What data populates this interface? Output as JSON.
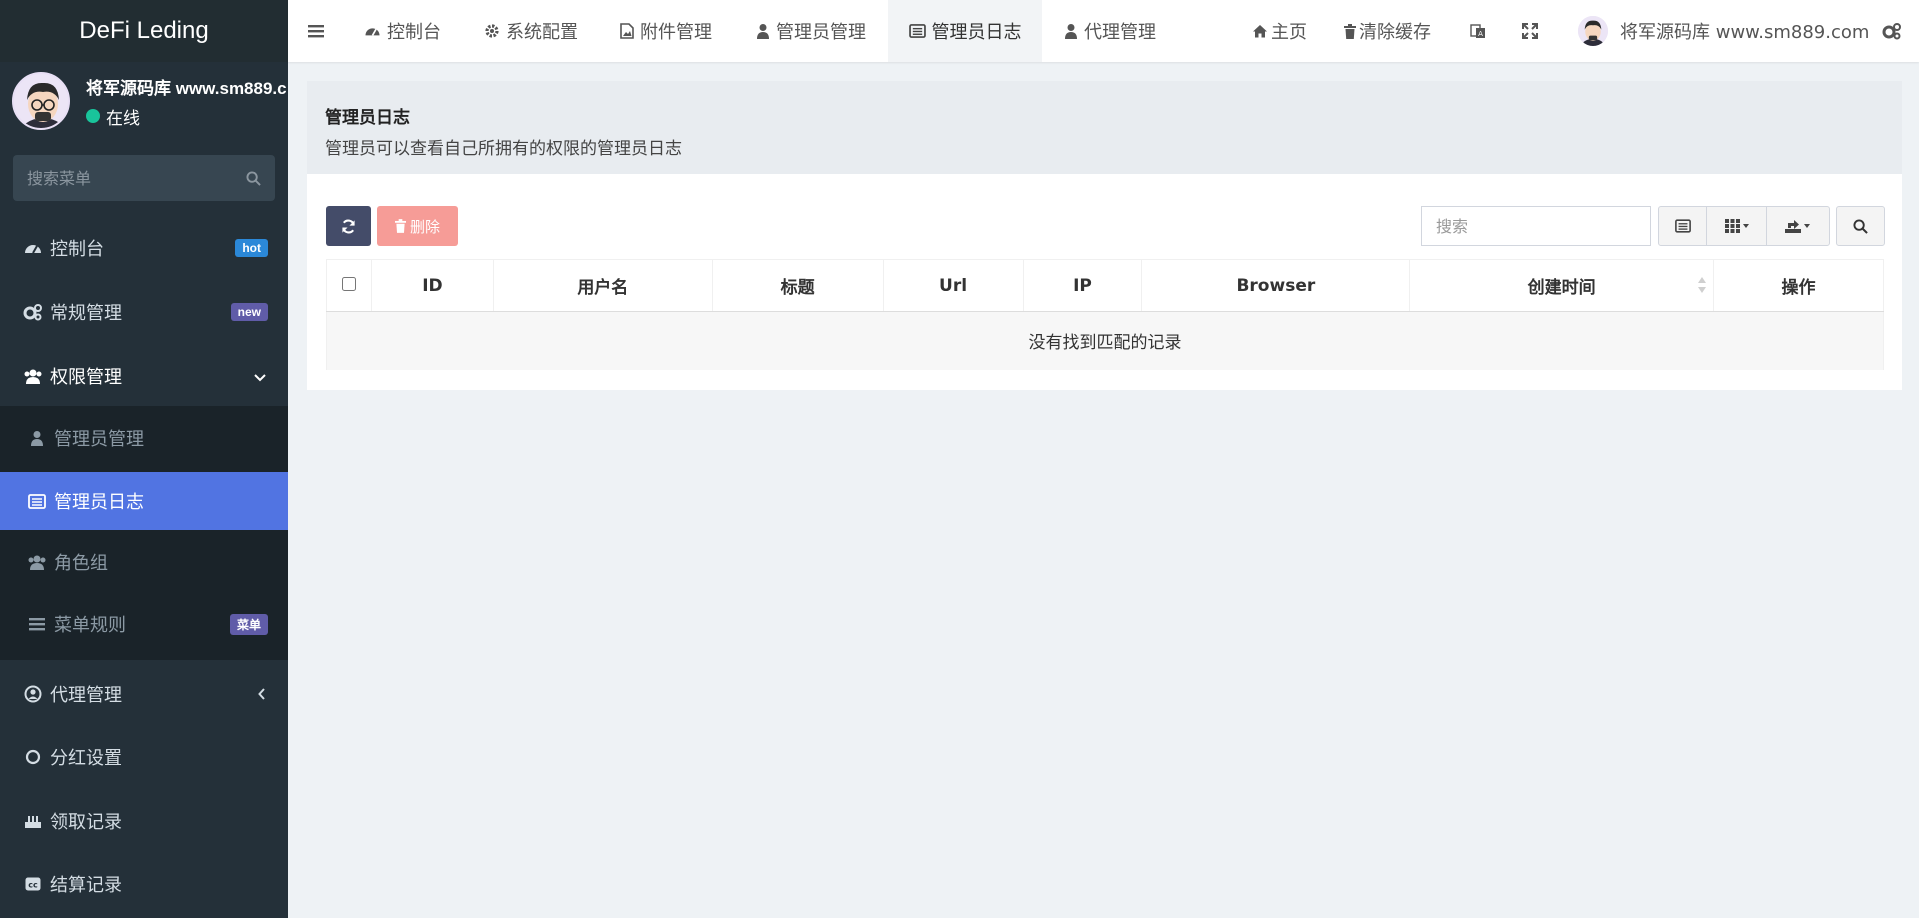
{
  "app": {
    "title": "DeFi Leding"
  },
  "user": {
    "name": "将军源码库 www.sm889.com",
    "name_truncated": "将军源码库 www.sm889.c",
    "status": "在线"
  },
  "sidebar": {
    "search_placeholder": "搜索菜单",
    "items": [
      {
        "label": "控制台",
        "icon": "dashboard-icon",
        "badge": "hot"
      },
      {
        "label": "常规管理",
        "icon": "cogs-icon",
        "badge": "new"
      },
      {
        "label": "权限管理",
        "icon": "group-icon",
        "expanded": true
      },
      {
        "label": "代理管理",
        "icon": "user-circle-icon",
        "collapsed": true
      },
      {
        "label": "分红设置",
        "icon": "circle-o-icon"
      },
      {
        "label": "领取记录",
        "icon": "birthday-cake-icon"
      },
      {
        "label": "结算记录",
        "icon": "creative-commons-icon"
      }
    ],
    "subitems": [
      {
        "label": "管理员管理",
        "icon": "user-icon"
      },
      {
        "label": "管理员日志",
        "icon": "list-alt-icon",
        "active": true
      },
      {
        "label": "角色组",
        "icon": "group-icon"
      },
      {
        "label": "菜单规则",
        "icon": "bars-icon",
        "badge": "菜单"
      }
    ]
  },
  "navbar": {
    "tabs": [
      {
        "label": "控制台",
        "icon": "dashboard-icon"
      },
      {
        "label": "系统配置",
        "icon": "cog-icon"
      },
      {
        "label": "附件管理",
        "icon": "file-image-icon"
      },
      {
        "label": "管理员管理",
        "icon": "user-icon"
      },
      {
        "label": "管理员日志",
        "icon": "list-alt-icon",
        "active": true
      },
      {
        "label": "代理管理",
        "icon": "user-icon"
      }
    ],
    "home": "主页",
    "clear_cache": "清除缓存",
    "user_name": "将军源码库 www.sm889.com"
  },
  "page": {
    "title": "管理员日志",
    "description": "管理员可以查看自己所拥有的权限的管理员日志"
  },
  "toolbar": {
    "delete_label": "删除",
    "search_placeholder": "搜索"
  },
  "table": {
    "columns": [
      "ID",
      "用户名",
      "标题",
      "Url",
      "IP",
      "Browser",
      "创建时间",
      "操作"
    ],
    "empty_text": "没有找到匹配的记录"
  },
  "colors": {
    "sidebar_bg": "#243039",
    "active_item": "#5174e2",
    "refresh_button": "#444c69",
    "delete_button": "#f69c97",
    "online_dot": "#19c49b"
  }
}
